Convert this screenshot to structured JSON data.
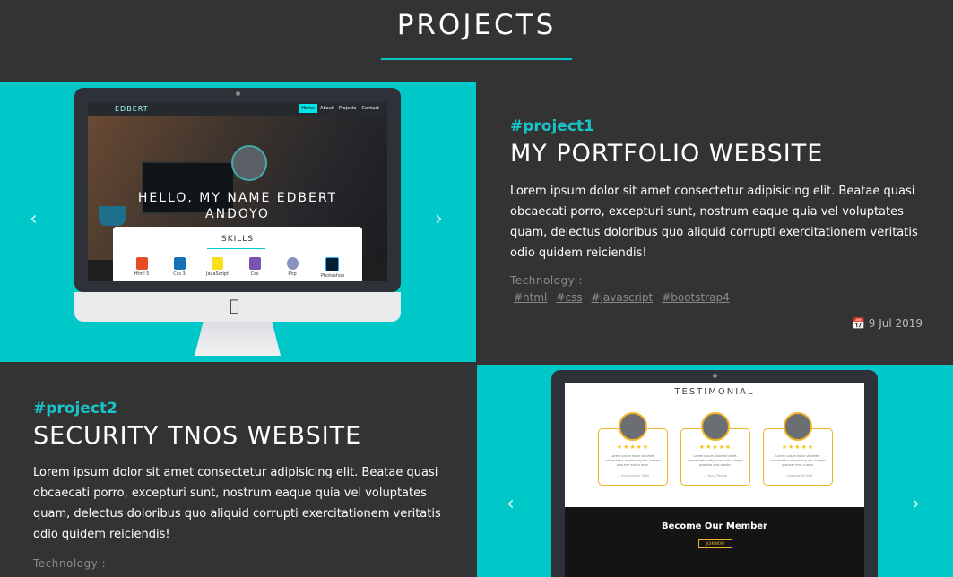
{
  "page": {
    "heading": "PROJECTS",
    "accent": "#00c8c8",
    "background": "#333333"
  },
  "carousel": {
    "prev_icon": "chevron-left-icon",
    "next_icon": "chevron-right-icon",
    "prev": "‹",
    "next": "›"
  },
  "project1": {
    "tag": "#project1",
    "title": "MY PORTFOLIO WEBSITE",
    "description": "Lorem ipsum dolor sit amet consectetur adipisicing elit. Beatae quasi obcaecati porro, excepturi sunt, nostrum eaque quia vel voluptates quam, delectus doloribus quo aliquid corrupti exercitationem veritatis odio quidem reiciendis!",
    "technology_label": "Technology :",
    "technologies": [
      "#html",
      "#css",
      "#javascript",
      "#bootstrap4"
    ],
    "date": "9 Jul 2019",
    "date_icon": "calendar-icon",
    "preview": {
      "logo": "EDBERT",
      "nav": [
        "Home",
        "About",
        "Projects",
        "Contact"
      ],
      "hero_text_line1": "HELLO, MY NAME EDBERT",
      "hero_text_line2": "ANDOYO",
      "skills_heading": "SKILLS",
      "skills": [
        {
          "label": "Html 5",
          "color": "#e44d26",
          "glyph": "5"
        },
        {
          "label": "Css 3",
          "color": "#1572b6",
          "glyph": "3"
        },
        {
          "label": "JavaScript",
          "color": "#f7df1e",
          "glyph": "JS"
        },
        {
          "label": "Css",
          "color": "#7952b3",
          "glyph": "B"
        },
        {
          "label": "Php",
          "color": "#8892be",
          "glyph": "php"
        },
        {
          "label": "Photoshop",
          "color": "#001e36",
          "glyph": "Ps"
        }
      ]
    }
  },
  "project2": {
    "tag": "#project2",
    "title": "SECURITY TNOS WEBSITE",
    "description": "Lorem ipsum dolor sit amet consectetur adipisicing elit. Beatae quasi obcaecati porro, excepturi sunt, nostrum eaque quia vel voluptates quam, delectus doloribus quo aliquid corrupti exercitationem veritatis odio quidem reiciendis!",
    "technology_label": "Technology :",
    "preview": {
      "heading": "TESTIMONIAL",
      "stars": "★★★★★",
      "card_text": "Lorem ipsum dolor sit amet, consectetur adipisicing elit. Integer posuere erat a ante.",
      "card_names": [
        "— Government Staff",
        "— Busy People",
        "— Associated Staff"
      ],
      "member_heading": "Become Our Member",
      "join_label": "JOIN NOW"
    }
  }
}
